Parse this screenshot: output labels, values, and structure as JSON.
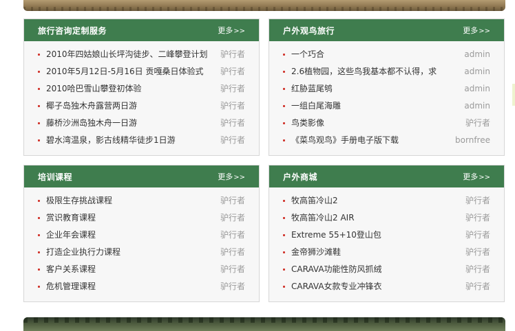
{
  "panels": [
    {
      "title": "旅行咨询定制服务",
      "more": "更多",
      "items": [
        {
          "title": "2010年四姑娘山长坪沟徒步、二峰攀登计划",
          "author": "驴行者"
        },
        {
          "title": "2010年5月12日-5月16日 贡嘎桑日体验式",
          "author": "驴行者"
        },
        {
          "title": "2010哈巴雪山攀登初体验",
          "author": "驴行者"
        },
        {
          "title": "椰子岛独木舟露营两日游",
          "author": "驴行者"
        },
        {
          "title": "藤桥沙洲岛独木舟一日游",
          "author": "驴行者"
        },
        {
          "title": "碧水湾温泉，影古线精华徒步1日游",
          "author": "驴行者"
        }
      ]
    },
    {
      "title": "户外观鸟旅行",
      "more": "更多",
      "items": [
        {
          "title": "一个巧合",
          "author": "admin"
        },
        {
          "title": "2.6植物园，这些鸟我基本都不认得，求",
          "author": "admin"
        },
        {
          "title": "红胁蓝尾鸲",
          "author": "admin"
        },
        {
          "title": "一组白尾海雕",
          "author": "admin"
        },
        {
          "title": "鸟类影像",
          "author": "驴行者"
        },
        {
          "title": "《菜鸟观鸟》手册电子版下载",
          "author": "bornfree"
        }
      ]
    },
    {
      "title": "培训课程",
      "more": "更多",
      "items": [
        {
          "title": "极限生存挑战课程",
          "author": "驴行者"
        },
        {
          "title": "赏识教育课程",
          "author": "驴行者"
        },
        {
          "title": "企业年会课程",
          "author": "驴行者"
        },
        {
          "title": "打造企业执行力课程",
          "author": "驴行者"
        },
        {
          "title": "客户关系课程",
          "author": "驴行者"
        },
        {
          "title": "危机管理课程",
          "author": "驴行者"
        }
      ]
    },
    {
      "title": "户外商城",
      "more": "更多",
      "items": [
        {
          "title": "牧高笛冷山2",
          "author": "驴行者"
        },
        {
          "title": "牧高笛冷山2 AIR",
          "author": "驴行者"
        },
        {
          "title": "Extreme 55+10登山包",
          "author": "驴行者"
        },
        {
          "title": "金帝狮沙滩鞋",
          "author": "驴行者"
        },
        {
          "title": "CARAVA功能性防风抓绒",
          "author": "驴行者"
        },
        {
          "title": "CARAVA女款专业冲锋衣",
          "author": "驴行者"
        }
      ]
    }
  ]
}
